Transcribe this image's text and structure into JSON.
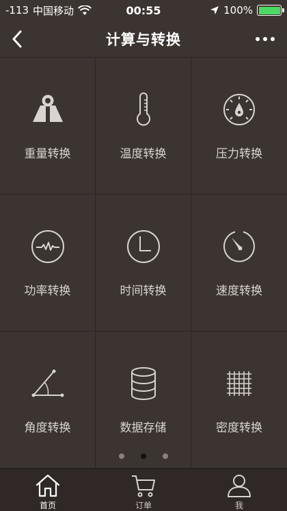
{
  "status_bar": {
    "signal": "-113",
    "carrier": "中国移动",
    "time": "00:55",
    "battery": "100%",
    "battery_color": "#4cd964"
  },
  "nav": {
    "title": "计算与转换",
    "back_icon": "chevron-left-icon",
    "more_icon": "more-dots-icon"
  },
  "grid": {
    "items": [
      {
        "label": "重量转换",
        "icon": "weight-icon"
      },
      {
        "label": "温度转换",
        "icon": "thermometer-icon"
      },
      {
        "label": "压力转换",
        "icon": "pressure-gauge-icon"
      },
      {
        "label": "功率转换",
        "icon": "pulse-icon"
      },
      {
        "label": "时间转换",
        "icon": "clock-icon"
      },
      {
        "label": "速度转换",
        "icon": "speedometer-icon"
      },
      {
        "label": "角度转换",
        "icon": "angle-icon"
      },
      {
        "label": "数据存储",
        "icon": "database-icon"
      },
      {
        "label": "密度转换",
        "icon": "grid-density-icon"
      }
    ]
  },
  "pager": {
    "count": 3,
    "active": 2
  },
  "tabs": [
    {
      "label": "首页",
      "icon": "home-icon",
      "active": true
    },
    {
      "label": "订单",
      "icon": "cart-icon",
      "active": false
    },
    {
      "label": "我",
      "icon": "user-icon",
      "active": false
    }
  ],
  "colors": {
    "background": "#3c3431",
    "tabbar": "#2f2826",
    "icon_stroke": "#d9d4d1"
  }
}
